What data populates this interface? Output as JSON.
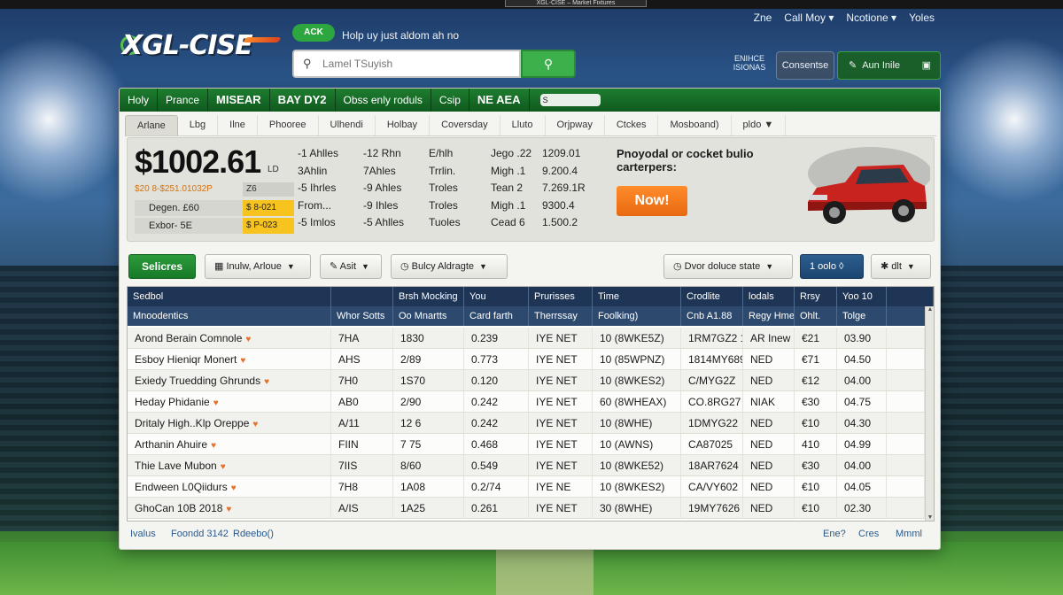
{
  "os": {
    "title": "XGL-CISE – Market Fixtures"
  },
  "brand": {
    "logo": "XGL-CISE",
    "badge": "ACK",
    "tagline": "Holp uy just aldom ah no"
  },
  "search": {
    "placeholder": "Lamel TSuyish",
    "button_icon": "search-icon"
  },
  "top_links": [
    "Zne",
    "Call Moy",
    "Ncotione",
    "Yoles"
  ],
  "account": {
    "sub_text": "ENIHCE ISIONAS",
    "consent_label": "Consentse",
    "auth_label": "Aun Inile"
  },
  "nav": {
    "items": [
      "Holy",
      "Prance",
      "MISEAR",
      "BAY DY2",
      "Obss enly roduls",
      "Csip",
      "NE AEA"
    ],
    "bold": [
      false,
      false,
      true,
      true,
      false,
      false,
      true
    ],
    "toggle_label": "S"
  },
  "tabs": [
    "Arlane",
    "Lbg",
    "Ilne",
    "Phooree",
    "Ulhendi",
    "Holbay",
    "Coversday",
    "Lluto",
    "Orjpway",
    "Ctckes",
    "Mosboand)",
    "pldo"
  ],
  "quote": {
    "price": "$1002.61",
    "price_unit": "LD",
    "change_text": "$20 8-$251.01032P",
    "change_box": "Z6",
    "rows": [
      {
        "label": "Degen. £60",
        "value": "$ 8-021",
        "highlight": true
      },
      {
        "label": "Exbor- 5E",
        "value": "$ P-023",
        "highlight": true
      }
    ],
    "col1": [
      "-1 Ahlles",
      "3Ahlin",
      "-5 Ihrles",
      "From...",
      "-5 Imlos"
    ],
    "col2": [
      "-12 Rhn",
      "7Ahles",
      "-9 Ahles",
      "-9 Ihles",
      "-5 Ahlles"
    ],
    "col3": [
      "E/hlh",
      "Trrlin.",
      "Troles",
      "Troles",
      "Tuoles"
    ],
    "col4": [
      "Jego .22",
      "Migh .1",
      "Tean 2",
      "Migh .1",
      "Cead 6"
    ],
    "col5": [
      "1209.01",
      "9.200.4",
      "7.269.1R",
      "9300.4",
      "1.500.2"
    ],
    "ad_text": "Pnoyodal or cocket bulio carterpers:",
    "ad_button": "Now!"
  },
  "toolbar": {
    "primary": "Selicres",
    "filter1": "Inulw, Arloue",
    "filter2": "Asit",
    "filter3": "Bulcy Aldragte",
    "filter4": "Dvor doluce state",
    "page": "1 oolo",
    "more": "dlt"
  },
  "table": {
    "header1": [
      "Sedbol",
      "",
      "Brsh Mocking",
      "You",
      "Prurisses",
      "Time",
      "Crodlite",
      "lodals",
      "Rrsy",
      "Yoo 10",
      ""
    ],
    "header2": [
      "Mnoodentics",
      "Whor Sotts",
      "Oo Mnartts",
      "Card farth",
      "Therrssay",
      "Foolking)",
      "Cnb A1.88",
      "Regy Hmes",
      "Ohlt.",
      "Tolge",
      ""
    ],
    "rows": [
      [
        "Arond Berain Comnole",
        "7HA",
        "1830",
        "0.239",
        "IYE NET",
        "10 (8WKE5Z)",
        "1RM7GZ2 1",
        "AR Inew",
        "€21",
        "03.90"
      ],
      [
        "Esboy Hieniqr Monert",
        "AHS",
        "2/89",
        "0.773",
        "IYE NET",
        "10 (85WPNZ)",
        "1814MY6894",
        "NED",
        "€71",
        "04.50"
      ],
      [
        "Exiedy Truedding Ghrunds",
        "7H0",
        "1S70",
        "0.120",
        "IYE NET",
        "10 (8WKES2)",
        "C/MYG2Z",
        "NED",
        "€12",
        "04.00"
      ],
      [
        "Heday Phidanie",
        "AB0",
        "2/90",
        "0.242",
        "IYE NET",
        "60 (8WHEAX)",
        "CO.8RG27",
        "NIAK",
        "€30",
        "04.75"
      ],
      [
        "Dritaly High..Klp Oreppe",
        "A/11",
        "12 6",
        "0.242",
        "IYE NET",
        "10 (8WHE)",
        "1DMYG22",
        "NED",
        "€10",
        "04.30"
      ],
      [
        "Arthanin Ahuire",
        "FIIN",
        "7 75",
        "0.468",
        "IYE NET",
        "10 (AWNS)",
        "CA87025",
        "NED",
        "410",
        "04.99"
      ],
      [
        "Thie Lave Mubon",
        "7IIS",
        "8/60",
        "0.549",
        "IYE NET",
        "10 (8WKE52)",
        "18AR7624",
        "NED",
        "€30",
        "04.00"
      ],
      [
        "Endween L0Qiidurs",
        "7H8",
        "1A08",
        "0.2/74",
        "IYE NE",
        "10 (8WKES2)",
        "CA/VY602",
        "NED",
        "€10",
        "04.05"
      ],
      [
        "GhoCan 10B 2018",
        "A/IS",
        "1A25",
        "0.261",
        "IYE NET",
        "30 (8WHE)",
        "19MY7626",
        "NED",
        "€10",
        "02.30"
      ]
    ]
  },
  "footer": {
    "left1": "Ivalus",
    "left2": "Foondd 3142",
    "left3": "Rdeebo()",
    "right1": "Ene?",
    "right2": "Cres",
    "right3": "Mmml"
  },
  "colors": {
    "nav_green": "#1e7d2f",
    "table_header": "#1e3555",
    "accent_orange": "#ff8c2b",
    "highlight_yellow": "#f7c31f"
  }
}
